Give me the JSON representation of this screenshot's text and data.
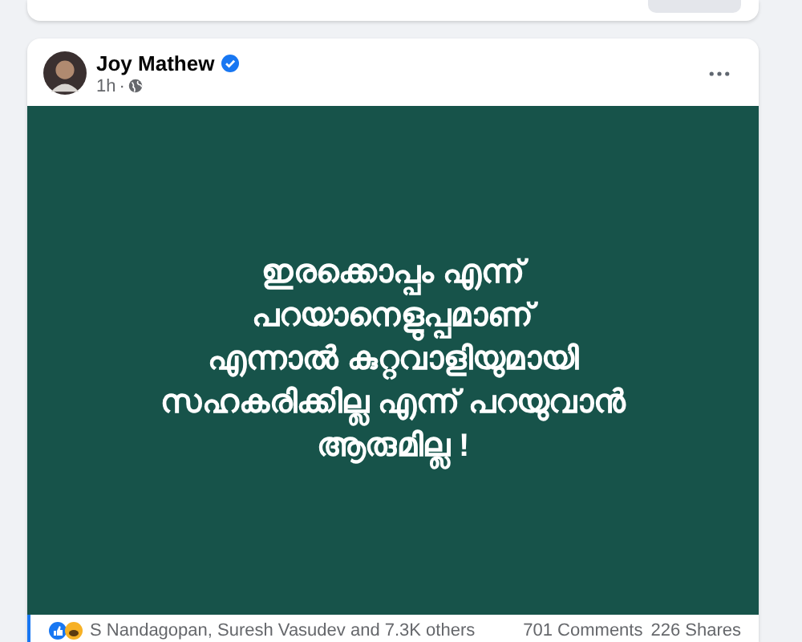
{
  "post": {
    "author": "Joy Mathew",
    "verified": true,
    "time": "1h",
    "separator": "·",
    "image_lines": [
      "ഇരക്കൊപ്പം എന്ന്",
      "പറയാനെളുപ്പമാണ്",
      "എന്നാൽ കുറ്റവാളിയുമായി",
      "സഹകരിക്കില്ല എന്ന് പറയുവാൻ",
      "ആരുമില്ല !"
    ],
    "reactions_text": "S Nandagopan, Suresh Vasudev and 7.3K others",
    "comments": "701 Comments",
    "shares": "226 Shares"
  }
}
